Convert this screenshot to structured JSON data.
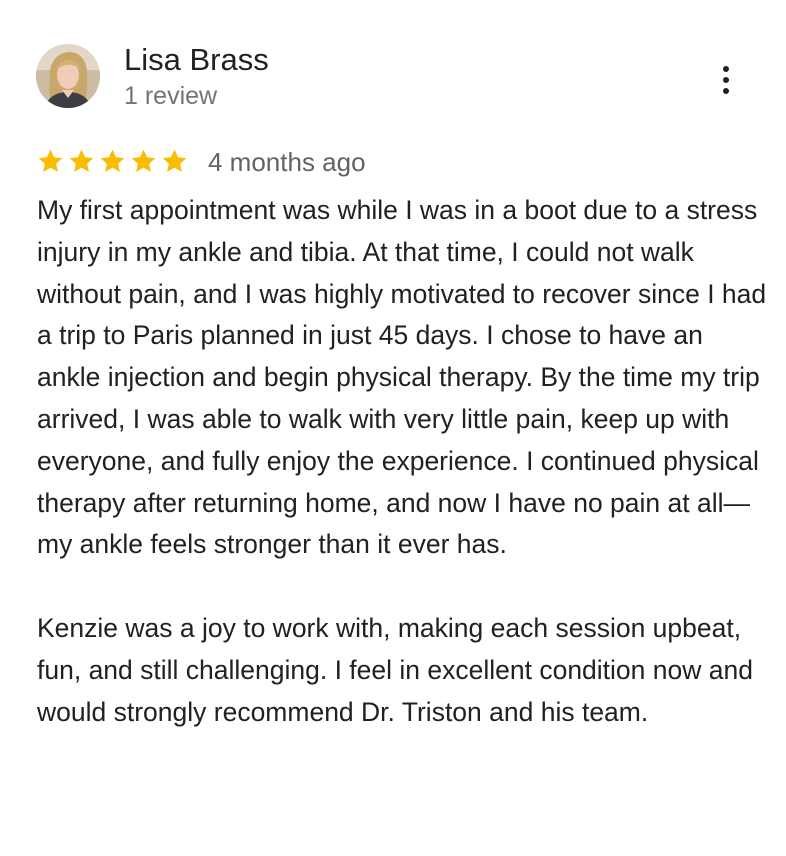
{
  "reviewer": {
    "name": "Lisa Brass",
    "review_count": "1 review"
  },
  "rating": {
    "stars": 5,
    "max_stars": 5,
    "star_color": "#fbbc04"
  },
  "review_date": "4 months ago",
  "review": {
    "paragraph_1": "My first appointment was while I was in a boot due to a stress injury in my ankle and tibia. At that time, I could not walk without pain, and I was highly motivated to recover since I had a trip to Paris planned in just 45 days. I chose to have an ankle injection and begin physical therapy. By the time my trip arrived, I was able to walk with very little pain, keep up with everyone, and fully enjoy the experience. I continued physical therapy after returning home, and now I have no pain at all—my ankle feels stronger than it ever has.",
    "paragraph_2": "Kenzie was a joy to work with, making each session upbeat, fun, and still challenging. I feel in excellent condition now and would strongly recommend Dr. Triston and his team."
  },
  "icons": {
    "more": "more-vert-icon",
    "star": "star-icon"
  }
}
